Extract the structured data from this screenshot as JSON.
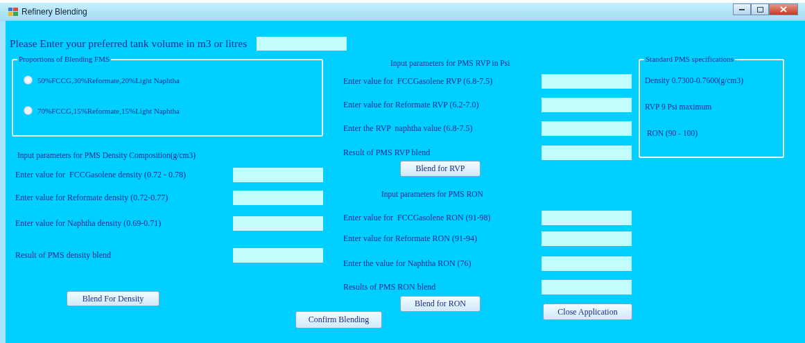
{
  "window": {
    "title": "Refinery Blending"
  },
  "tank_volume": {
    "label": "Please Enter your preferred tank volume in m3 or litres"
  },
  "proportions": {
    "title": "Proportions of Blending FMS",
    "options": [
      {
        "label": "50%FCCG,30%Reformate,20%Light Naphtha",
        "selected": false
      },
      {
        "label": "70%FCCG,15%Reformate,15%Light Naphtha",
        "selected": false
      }
    ]
  },
  "density": {
    "heading": "Input parameters for PMS Density Composition(g/cm3)",
    "fields": [
      {
        "label": "Enter value for  FCCGasolene density (0.72 - 0.78)"
      },
      {
        "label": "Enter value for Reformate density (0.72-0.77)"
      },
      {
        "label": "Enter value for Naphtha density (0.69-0.71)"
      },
      {
        "label": "Result of PMS density blend"
      }
    ],
    "button": "Blend For Density"
  },
  "rvp": {
    "heading": "Input parameters for PMS RVP in Psi",
    "fields": [
      {
        "label": "Enter value for  FCCGasolene RVP (6.8-7.5)"
      },
      {
        "label": "Enter value for Reformate RVP (6.2-7.0)"
      },
      {
        "label": "Enter the RVP  naphtha value (6.8-7.5)"
      },
      {
        "label": "Result of PMS RVP blend"
      }
    ],
    "button": "Blend for RVP"
  },
  "ron": {
    "heading": "Input parameters for PMS RON",
    "fields": [
      {
        "label": "Enter value for  FCCGasolene RON (91-98)"
      },
      {
        "label": "Enter value for Reformate RON (91-94)"
      },
      {
        "label": "Enter the value for Naphtha RON (76)"
      },
      {
        "label": "Results of PMS RON blend"
      }
    ],
    "button": "Blend for RON"
  },
  "specs": {
    "title": "Standard PMS specifications",
    "lines": [
      "Density 0.7300-0.7600(g/cm3)",
      "RVP 9 Psi maximum",
      " RON (90 - 100)"
    ]
  },
  "buttons": [
    "Confirm Blending",
    "Close Application"
  ]
}
